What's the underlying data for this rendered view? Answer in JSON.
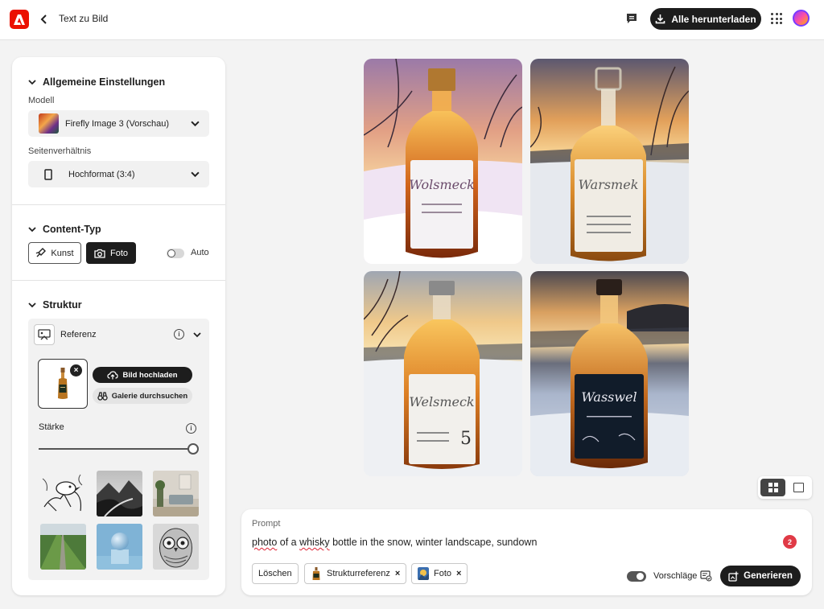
{
  "header": {
    "title": "Text zu Bild",
    "download_all": "Alle herunterladen"
  },
  "general": {
    "heading": "Allgemeine Einstellungen",
    "model_label": "Modell",
    "model_value": "Firefly Image 3 (Vorschau)",
    "aspect_label": "Seitenverhältnis",
    "aspect_value": "Hochformat (3:4)"
  },
  "content_type": {
    "heading": "Content-Typ",
    "options": [
      "Kunst",
      "Foto"
    ],
    "selected": "Foto",
    "auto_label": "Auto",
    "auto_enabled": false
  },
  "structure": {
    "heading": "Struktur",
    "reference_label": "Referenz",
    "upload_label": "Bild hochladen",
    "gallery_label": "Galerie durchsuchen",
    "strength_label": "Stärke",
    "strength_value": 1.0,
    "presets": [
      "bird-sketch",
      "mountain-landscape",
      "living-room",
      "green-field-road",
      "blue-sphere",
      "owl-drawing"
    ]
  },
  "results": {
    "images": [
      {
        "label_text": "Wolsmeck",
        "label_bg": "#f4f2f4",
        "cap": "#b07830"
      },
      {
        "label_text": "Warsmek",
        "label_bg": "#f0ece4",
        "cap": "#c8c0b0"
      },
      {
        "label_text": "Welsmeck",
        "label_bg": "#f2f0ec",
        "cap": "#8a8a8a"
      },
      {
        "label_text": "Wasswel",
        "label_bg": "#111c2a",
        "cap": "#2a1f1a"
      }
    ]
  },
  "view": {
    "active": "grid"
  },
  "prompt": {
    "label": "Prompt",
    "words": [
      {
        "t": "photo",
        "spell": true
      },
      {
        "t": " of a ",
        "spell": false
      },
      {
        "t": "whisky",
        "spell": true
      },
      {
        "t": " bottle in the snow, winter landscape, sundown",
        "spell": false
      }
    ],
    "badge": "2",
    "clear_label": "Löschen",
    "chips": [
      {
        "label": "Strukturreferenz"
      },
      {
        "label": "Foto"
      }
    ],
    "suggestions_label": "Vorschläge",
    "suggestions_enabled": true,
    "generate_label": "Generieren"
  },
  "colors": {
    "accent_dark": "#1d1d1d",
    "adobe_red": "#eb1000",
    "badge_red": "#e03a46"
  }
}
